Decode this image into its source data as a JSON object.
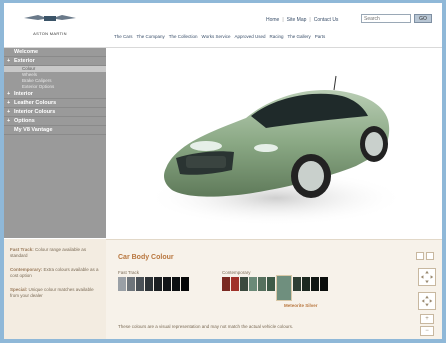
{
  "brand": {
    "logo_text": "ASTON MARTIN"
  },
  "top_links": {
    "home": "Home",
    "site_map": "Site Map",
    "contact": "Contact Us",
    "search_placeholder": "Search",
    "go": "GO"
  },
  "main_nav": [
    "The Cars",
    "The Company",
    "The Collection",
    "Works Service",
    "Approved Used",
    "Racing",
    "The Gallery",
    "Parts"
  ],
  "sidebar": {
    "items": [
      {
        "label": "Welcome",
        "prefix": ""
      },
      {
        "label": "Exterior",
        "prefix": "+"
      },
      {
        "label": "Colour",
        "sub": true,
        "active": true
      },
      {
        "label": "Wheels",
        "sub": true
      },
      {
        "label": "Brake Calipers",
        "sub": true
      },
      {
        "label": "Exterior Options",
        "sub": true
      },
      {
        "label": "Interior",
        "prefix": "+"
      },
      {
        "label": "Leather Colours",
        "prefix": "+"
      },
      {
        "label": "Interior Colours",
        "prefix": "+"
      },
      {
        "label": "Options",
        "prefix": "+"
      },
      {
        "label": "My V8 Vantage",
        "prefix": ""
      }
    ]
  },
  "tips": [
    {
      "title": "Fast Track:",
      "text": "Colour range available as standard"
    },
    {
      "title": "Contemporary:",
      "text": "Extra colours available as a cost option"
    },
    {
      "title": "Special:",
      "text": "Unique colour matches available from your dealer"
    }
  ],
  "colour_panel": {
    "title": "Car Body Colour",
    "fast_track_label": "Fast Track",
    "contemporary_label": "Contemporary",
    "selected_name": "Meteorite Silver",
    "disclaimer": "These colours are a visual representation and may not match the actual vehicle colours.",
    "fast_track_colors": [
      "#9aa0a6",
      "#6e757b",
      "#4a5157",
      "#2c3236",
      "#1b1f22",
      "#121518",
      "#0d1012",
      "#060708"
    ],
    "contemporary_colors": [
      "#7a2a22",
      "#a0322a",
      "#3b4a3e",
      "#6b8a78",
      "#56705e",
      "#3e5a48",
      "#6f8f7e",
      "#2e3e34",
      "#1c2820",
      "#0f1512",
      "#0a0d0b"
    ],
    "selected_index": 6
  },
  "colors": {
    "car_body": "#8aa884",
    "accent": "#b8763e",
    "sidebar_bg": "#9a9a9a"
  }
}
